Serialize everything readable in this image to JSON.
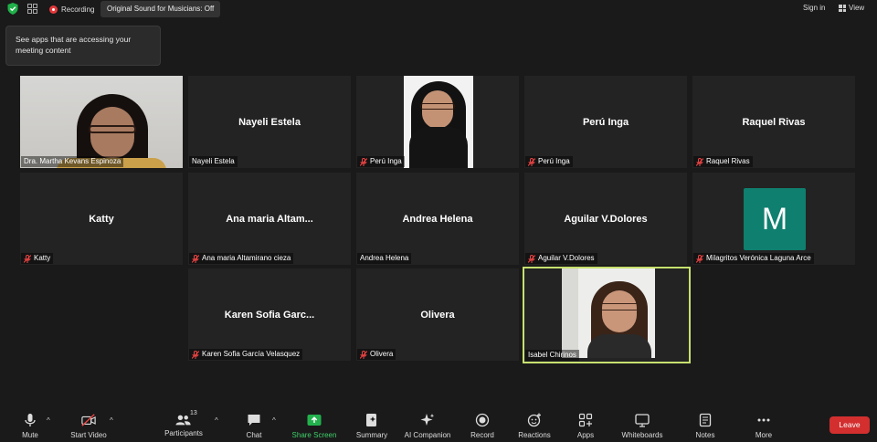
{
  "topbar": {
    "recording_label": "Recording",
    "original_sound_label": "Original Sound for Musicians: Off",
    "signin_label": "Sign in",
    "view_label": "View"
  },
  "tooltip": {
    "text": "See apps that are accessing your meeting content"
  },
  "tiles": [
    {
      "label": "Dra. Martha Kevans Espinoza",
      "display_name": "",
      "muted": false,
      "video": true
    },
    {
      "label": "Nayeli Estela",
      "display_name": "Nayeli Estela",
      "muted": false,
      "video": false
    },
    {
      "label": "Perú Inga",
      "display_name": "",
      "muted": true,
      "video": true
    },
    {
      "label": "Perú Inga",
      "display_name": "Perú Inga",
      "muted": true,
      "video": false
    },
    {
      "label": "Raquel Rivas",
      "display_name": "Raquel Rivas",
      "muted": true,
      "video": false
    },
    {
      "label": "Katty",
      "display_name": "Katty",
      "muted": true,
      "video": false
    },
    {
      "label": "Ana maria Altamirano cieza",
      "display_name": "Ana maria Altam...",
      "muted": true,
      "video": false
    },
    {
      "label": "Andrea Helena",
      "display_name": "Andrea Helena",
      "muted": false,
      "video": false
    },
    {
      "label": "Aguilar V.Dolores",
      "display_name": "Aguilar V.Dolores",
      "muted": true,
      "video": false
    },
    {
      "label": "Milagritos Verónica Laguna Arce",
      "display_name": "M",
      "muted": true,
      "video": false,
      "avatar_color": "#0f7f6f"
    },
    {
      "label": "Karen Sofia García Velasquez",
      "display_name": "Karen Sofia Garc...",
      "muted": true,
      "video": false
    },
    {
      "label": "Olivera",
      "display_name": "Olivera",
      "muted": true,
      "video": false
    },
    {
      "label": "Isabel Chirinos",
      "display_name": "",
      "muted": false,
      "video": true,
      "active_speaker": true
    }
  ],
  "toolbar": {
    "mute": "Mute",
    "start_video": "Start Video",
    "participants": "Participants",
    "participants_count": "13",
    "chat": "Chat",
    "share_screen": "Share Screen",
    "summary": "Summary",
    "ai_companion": "AI Companion",
    "record": "Record",
    "reactions": "Reactions",
    "apps": "Apps",
    "whiteboards": "Whiteboards",
    "notes": "Notes",
    "more": "More",
    "leave": "Leave"
  },
  "colors": {
    "accent_green": "#3fcf6a",
    "leave_red": "#d32f2f",
    "active_border": "#c6e06e",
    "avatar_teal": "#0f7f6f"
  }
}
